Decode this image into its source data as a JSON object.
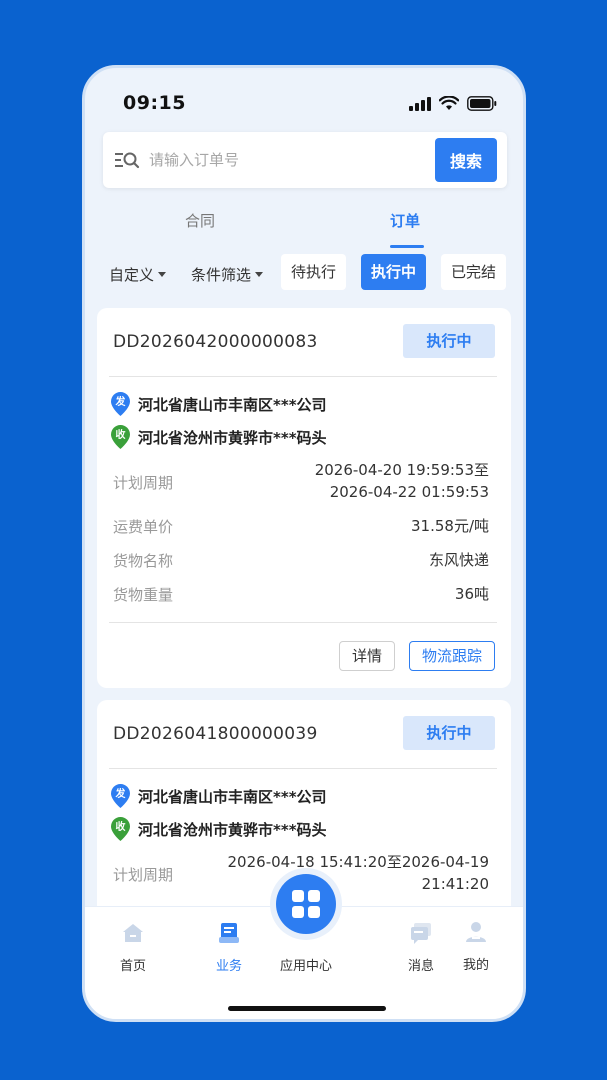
{
  "status_bar": {
    "time": "09:15"
  },
  "search": {
    "placeholder": "请输入订单号",
    "button_label": "搜索"
  },
  "tabs": [
    {
      "label": "合同",
      "active": false
    },
    {
      "label": "订单",
      "active": true
    }
  ],
  "filters": {
    "custom_label": "自定义",
    "condition_label": "条件筛选",
    "pills": [
      {
        "label": "待执行",
        "active": false
      },
      {
        "label": "执行中",
        "active": true
      },
      {
        "label": "已完结",
        "active": false
      }
    ]
  },
  "orders": [
    {
      "order_no": "DD2026042000000083",
      "status": "执行中",
      "from_tag": "发",
      "from": "河北省唐山市丰南区***公司",
      "to_tag": "收",
      "to": "河北省沧州市黄骅市***码头",
      "plan_label": "计划周期",
      "plan_line1": "2026-04-20 19:59:53至",
      "plan_line2": "2026-04-22 01:59:53",
      "price_label": "运费单价",
      "price": "31.58元/吨",
      "goods_label": "货物名称",
      "goods": "东风快递",
      "weight_label": "货物重量",
      "weight": "36吨",
      "detail_btn": "详情",
      "track_btn": "物流跟踪"
    },
    {
      "order_no": "DD2026041800000039",
      "status": "执行中",
      "from_tag": "发",
      "from": "河北省唐山市丰南区***公司",
      "to_tag": "收",
      "to": "河北省沧州市黄骅市***码头",
      "plan_label": "计划周期",
      "plan_line1": "2026-04-18 15:41:20至2026-04-19",
      "plan_line2": "21:41:20"
    }
  ],
  "tabbar": {
    "items": [
      {
        "label": "首页",
        "icon": "home-icon"
      },
      {
        "label": "业务",
        "icon": "business-icon",
        "active": true
      },
      {
        "label": "应用中心",
        "icon": "app-grid-icon"
      },
      {
        "label": "消息",
        "icon": "message-icon"
      },
      {
        "label": "我的",
        "icon": "profile-icon"
      }
    ]
  },
  "colors": {
    "accent": "#2d7df1",
    "background": "#0a62cf",
    "from_pin": "#2d7df1",
    "to_pin": "#3aa03a"
  }
}
